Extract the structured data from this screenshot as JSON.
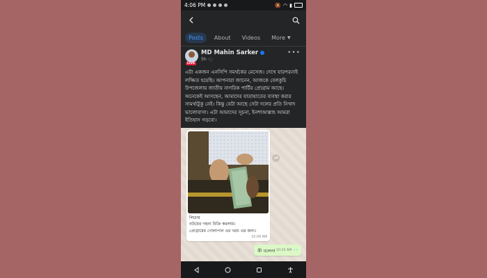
{
  "status": {
    "time": "4:06 PM"
  },
  "tabs": [
    {
      "label": "Posts"
    },
    {
      "label": "About"
    },
    {
      "label": "Videos"
    },
    {
      "label": "More"
    }
  ],
  "post": {
    "author": "MD Mahin Sarker",
    "age": "5h",
    "live_badge": "LIVE",
    "text": "এটা একজন এনসিপি সমর্থকের মেসেজ। দেখে যারপরনাই লজ্জিত হয়েছি। আপনারা জানেন, আজকে বেলকুচি উপজেলায় জাতীয় নাগরিক পার্টির প্রোগ্রাম আছে। অনেকেই আসছেন, আমাদের যাতায়াতের ব্যবস্থা করার সামর্থ্যটুকু নেই। কিন্তু যেটা আছে সেটা দলের প্রতি নিখাদ ভালোবাসা। এটা আমাদের সূচনা, ইনশাআল্লাহ আমরা ইতিহাস গড়বো।"
  },
  "chat": {
    "incoming_lines": [
      "লিডার",
      "বউয়ের গহনা বিক্রি করলাম।",
      "প্রোগ্রামের গোলাপান এর খরচ এর জন্য।"
    ],
    "incoming_time": "10:09 AM",
    "outgoing_text": "কী বলেন!",
    "outgoing_time": "10:10 AM"
  },
  "colors": {
    "accent": "#4599ff",
    "background": "#a56565",
    "surface": "#242526"
  }
}
